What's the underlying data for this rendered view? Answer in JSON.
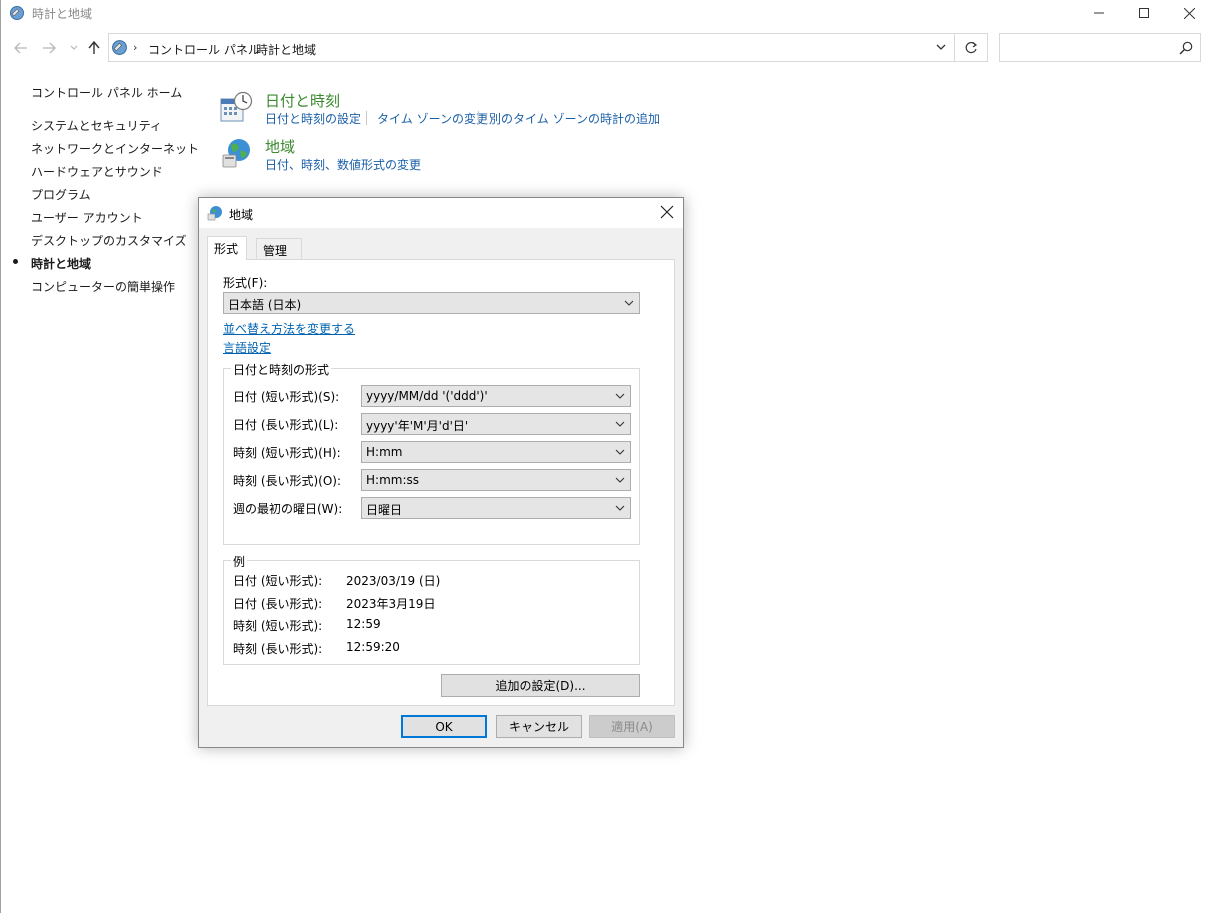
{
  "window": {
    "title": "時計と地域"
  },
  "address": {
    "crumbs": [
      "コントロール パネル",
      "時計と地域"
    ]
  },
  "search": {
    "placeholder": ""
  },
  "sidebar": {
    "items": [
      {
        "label": "コントロール パネル ホーム",
        "active": false
      },
      {
        "label": "システムとセキュリティ",
        "active": false
      },
      {
        "label": "ネットワークとインターネット",
        "active": false
      },
      {
        "label": "ハードウェアとサウンド",
        "active": false
      },
      {
        "label": "プログラム",
        "active": false
      },
      {
        "label": "ユーザー アカウント",
        "active": false
      },
      {
        "label": "デスクトップのカスタマイズ",
        "active": false
      },
      {
        "label": "時計と地域",
        "active": true
      },
      {
        "label": "コンピューターの簡単操作",
        "active": false
      }
    ]
  },
  "categories": [
    {
      "title": "日付と時刻",
      "icon": "calendar-clock-icon",
      "links": [
        "日付と時刻の設定",
        "タイム ゾーンの変更",
        "別のタイム ゾーンの時計の追加"
      ]
    },
    {
      "title": "地域",
      "icon": "globe-icon",
      "links": [
        "日付、時刻、数値形式の変更"
      ]
    }
  ],
  "dialog": {
    "title": "地域",
    "tabs": [
      "形式",
      "管理"
    ],
    "format_label": "形式(F):",
    "format_value": "日本語 (日本)",
    "link_sort": "並べ替え方法を変更する",
    "link_language": "言語設定",
    "group_datetime": "日付と時刻の形式",
    "fields": [
      {
        "label": "日付 (短い形式)(S):",
        "value": "yyyy/MM/dd  '('ddd')'"
      },
      {
        "label": "日付 (長い形式)(L):",
        "value": "yyyy'年'M'月'd'日'"
      },
      {
        "label": "時刻 (短い形式)(H):",
        "value": "H:mm"
      },
      {
        "label": "時刻 (長い形式)(O):",
        "value": "H:mm:ss"
      },
      {
        "label": "週の最初の曜日(W):",
        "value": "日曜日"
      }
    ],
    "group_example": "例",
    "examples": [
      {
        "label": "日付 (短い形式):",
        "value": "2023/03/19 (日)"
      },
      {
        "label": "日付 (長い形式):",
        "value": "2023年3月19日"
      },
      {
        "label": "時刻 (短い形式):",
        "value": "12:59"
      },
      {
        "label": "時刻 (長い形式):",
        "value": "12:59:20"
      }
    ],
    "additional_settings": "追加の設定(D)...",
    "ok": "OK",
    "cancel": "キャンセル",
    "apply": "適用(A)"
  }
}
